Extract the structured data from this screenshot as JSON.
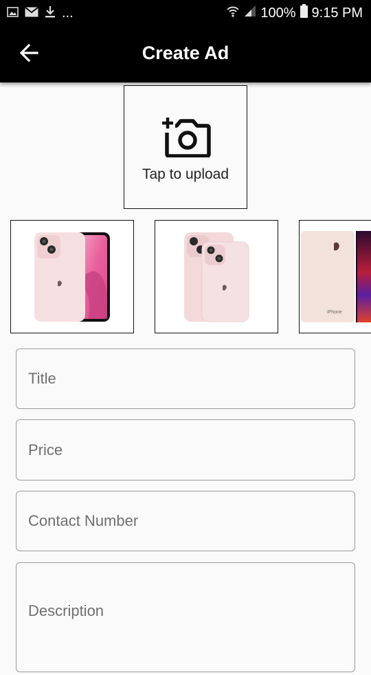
{
  "status_bar": {
    "battery": "100%",
    "time": "9:15 PM",
    "overflow": "..."
  },
  "header": {
    "title": "Create Ad"
  },
  "upload": {
    "label": "Tap to upload"
  },
  "thumbnails": [
    {
      "alt": "pink phone with screen"
    },
    {
      "alt": "two pink phones back"
    },
    {
      "alt": "phone back and front"
    }
  ],
  "form": {
    "title_placeholder": "Title",
    "price_placeholder": "Price",
    "contact_placeholder": "Contact Number",
    "description_placeholder": "Description"
  },
  "colors": {
    "appbar": "#000000",
    "background": "#fafafa",
    "phone_pink": "#f6dfe0"
  }
}
